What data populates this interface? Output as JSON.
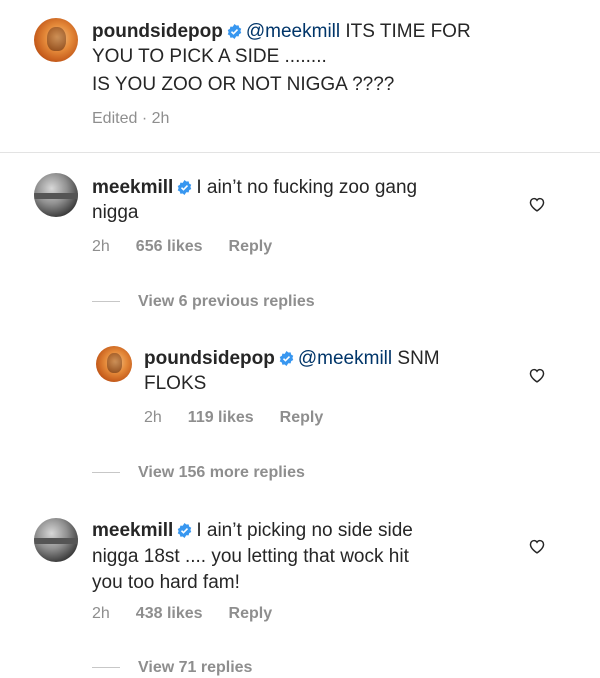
{
  "caption": {
    "username": "poundsidepop",
    "mention": "@meekmill",
    "text_line1": "ITS TIME FOR",
    "text_line2": "YOU TO PICK A SIDE ........",
    "text_line3": "IS YOU ZOO OR NOT NIGGA ????",
    "edited": "Edited · 2h"
  },
  "comments": [
    {
      "username": "meekmill",
      "text_line1": "I ain’t no fucking zoo gang",
      "text_line2": "nigga",
      "time": "2h",
      "likes": "656 likes",
      "reply": "Reply",
      "view_replies": "View 6 previous replies"
    },
    {
      "username": "poundsidepop",
      "mention": "@meekmill",
      "text_line1": "SNM",
      "text_line2": "FLOKS",
      "time": "2h",
      "likes": "119 likes",
      "reply": "Reply",
      "view_replies": "View 156 more replies"
    },
    {
      "username": "meekmill",
      "text_line1": "I ain’t picking no side side",
      "text_line2": "nigga 18st .... you letting that wock hit",
      "text_line3": "you too hard fam!",
      "time": "2h",
      "likes": "438 likes",
      "reply": "Reply",
      "view_replies": "View 71 replies"
    }
  ],
  "icons": {
    "verified": "verified-badge-icon",
    "heart": "heart-outline-icon"
  },
  "colors": {
    "verified_blue": "#3897f0",
    "mention": "#003569",
    "secondary": "#8e8e8e"
  }
}
